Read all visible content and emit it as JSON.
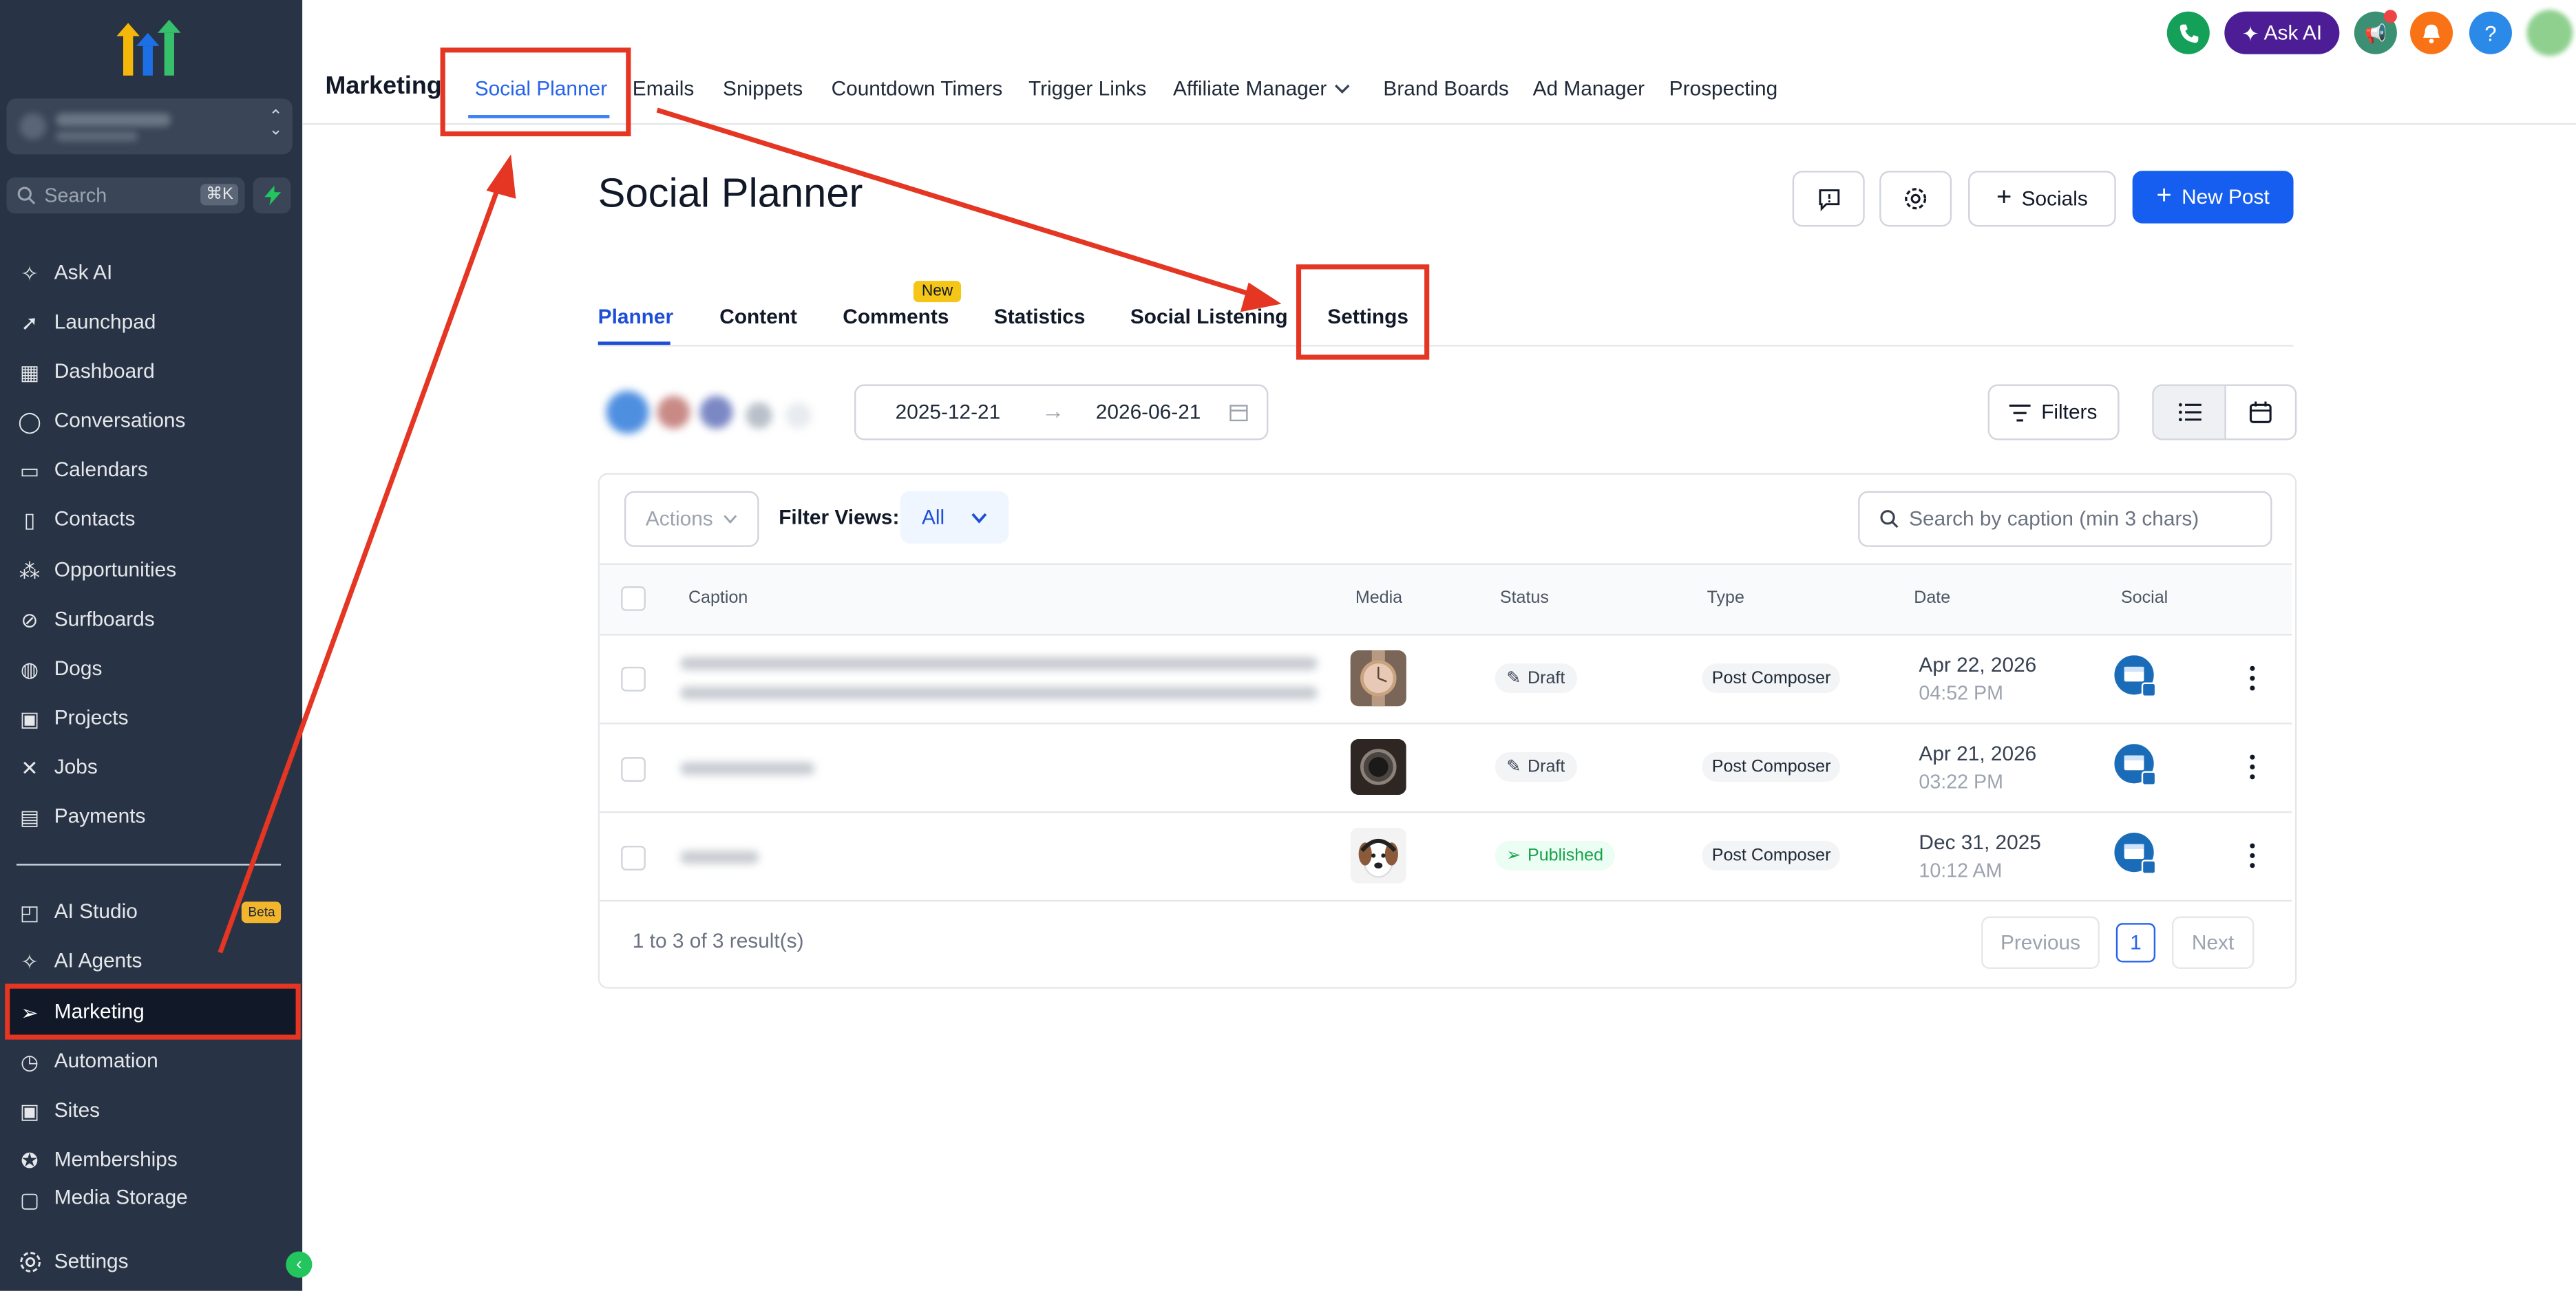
{
  "colors": {
    "sidebar_bg": "#283445",
    "accent": "#155eef",
    "annotation_red": "#e53523",
    "published_green": "#16a34a",
    "new_badge": "#f5c518"
  },
  "sidebar": {
    "search_placeholder": "Search",
    "search_shortcut": "⌘K",
    "items": [
      {
        "label": "Ask AI",
        "icon": "sparkle-icon"
      },
      {
        "label": "Launchpad",
        "icon": "rocket-icon"
      },
      {
        "label": "Dashboard",
        "icon": "grid-icon"
      },
      {
        "label": "Conversations",
        "icon": "chat-icon"
      },
      {
        "label": "Calendars",
        "icon": "calendar-icon"
      },
      {
        "label": "Contacts",
        "icon": "contacts-icon"
      },
      {
        "label": "Opportunities",
        "icon": "funnel-icon"
      },
      {
        "label": "Surfboards",
        "icon": "surfboard-icon"
      },
      {
        "label": "Dogs",
        "icon": "dog-icon"
      },
      {
        "label": "Projects",
        "icon": "projects-icon"
      },
      {
        "label": "Jobs",
        "icon": "tools-icon"
      },
      {
        "label": "Payments",
        "icon": "receipt-icon"
      },
      {
        "label": "AI Studio",
        "icon": "ai-studio-icon",
        "badge": "Beta"
      },
      {
        "label": "AI Agents",
        "icon": "sparkle-icon"
      },
      {
        "label": "Marketing",
        "icon": "send-icon",
        "active": true
      },
      {
        "label": "Automation",
        "icon": "automation-icon"
      },
      {
        "label": "Sites",
        "icon": "sites-icon"
      },
      {
        "label": "Memberships",
        "icon": "badge-icon"
      },
      {
        "label": "Media Storage",
        "icon": "folder-icon"
      }
    ],
    "settings_label": "Settings"
  },
  "topnav": {
    "section_title": "Marketing",
    "tabs": [
      "Social Planner",
      "Emails",
      "Snippets",
      "Countdown Timers",
      "Trigger Links",
      "Affiliate Manager",
      "Brand Boards",
      "Ad Manager",
      "Prospecting"
    ],
    "active_tab": "Social Planner",
    "ask_ai_label": "Ask AI",
    "help_label": "?"
  },
  "page": {
    "title": "Social Planner",
    "socials_button": "Socials",
    "new_post_button": "New Post",
    "subtabs": [
      "Planner",
      "Content",
      "Comments",
      "Statistics",
      "Social Listening",
      "Settings"
    ],
    "active_subtab": "Planner",
    "new_badge": "New",
    "date_from": "2025-12-21",
    "date_to": "2026-06-21",
    "filters_button": "Filters"
  },
  "table": {
    "actions_label": "Actions",
    "filter_views_label": "Filter Views:",
    "filter_views_value": "All",
    "search_placeholder": "Search by caption (min 3 chars)",
    "headers": [
      "Caption",
      "Media",
      "Status",
      "Type",
      "Date",
      "Social"
    ],
    "rows": [
      {
        "status": "Draft",
        "type": "Post Composer",
        "date": "Apr 22, 2026",
        "time": "04:52 PM",
        "media": "watch-gold"
      },
      {
        "status": "Draft",
        "type": "Post Composer",
        "date": "Apr 21, 2026",
        "time": "03:22 PM",
        "media": "watch-black"
      },
      {
        "status": "Published",
        "type": "Post Composer",
        "date": "Dec 31, 2025",
        "time": "10:12 AM",
        "media": "dog-headphones"
      }
    ],
    "results_text": "1 to 3 of 3 result(s)",
    "previous_label": "Previous",
    "current_page": "1",
    "next_label": "Next"
  }
}
